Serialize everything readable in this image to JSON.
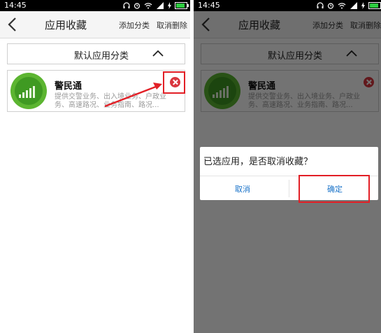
{
  "status_bar": {
    "time": "14:45",
    "battery_level": 0.85
  },
  "header": {
    "title": "应用收藏",
    "add_category": "添加分类",
    "remove_favorites": "取消删除"
  },
  "category": {
    "label": "默认应用分类"
  },
  "app": {
    "name": "警民通",
    "description": "提供交警业务、出入境业务、户政业务、高速路况、业务指南、路况..."
  },
  "dialog": {
    "message": "已选应用，是否取消收藏？",
    "cancel": "取消",
    "confirm": "确定"
  },
  "colors": {
    "highlight": "#e21f26",
    "remove_icon": "#d9363e",
    "app_green": "#5cb531",
    "dialog_button": "#1a73c9"
  },
  "icons": [
    "back-icon",
    "headphone-icon",
    "alarm-icon",
    "wifi-icon",
    "signal-icon",
    "battery-icon",
    "chevron-up-icon",
    "remove-icon"
  ]
}
